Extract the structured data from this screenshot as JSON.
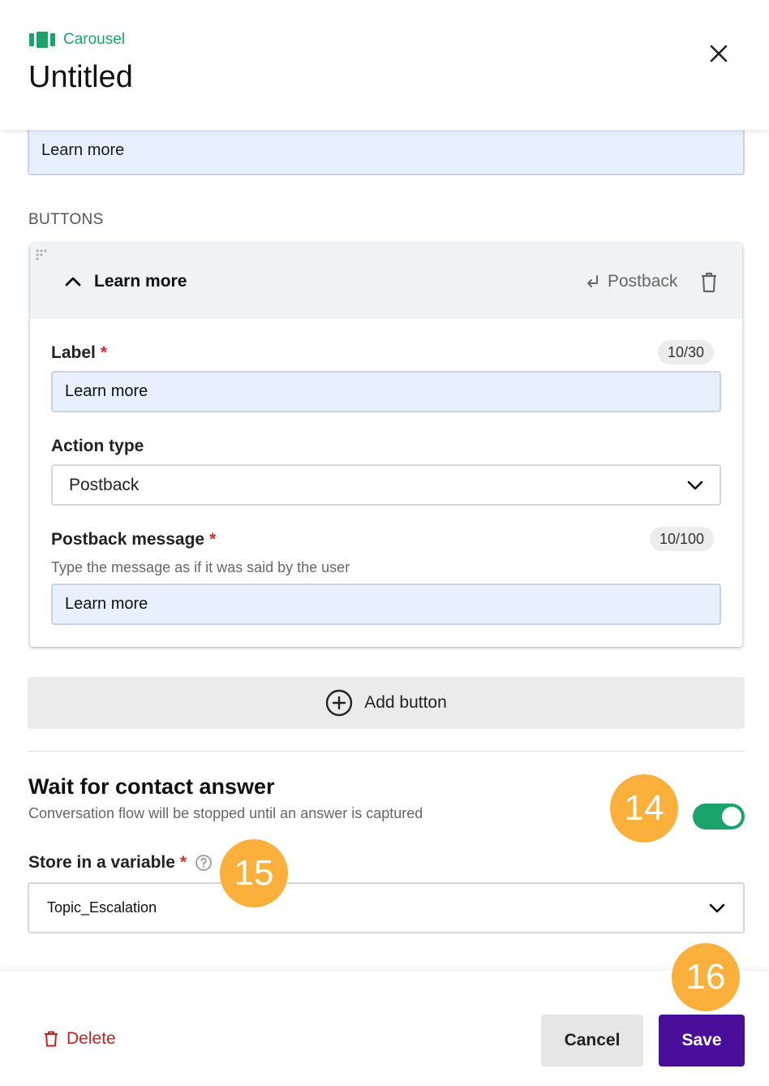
{
  "header": {
    "type_label": "Carousel",
    "title": "Untitled"
  },
  "content": {
    "top_input_value": "Learn more",
    "buttons_section_label": "BUTTONS",
    "button_card": {
      "name": "Learn more",
      "action_indicator": "Postback",
      "label_field": {
        "label": "Label",
        "required_mark": "*",
        "counter": "10/30",
        "value": "Learn more"
      },
      "action_type_field": {
        "label": "Action type",
        "selected": "Postback"
      },
      "postback_field": {
        "label": "Postback message",
        "required_mark": "*",
        "counter": "10/100",
        "helper": "Type the message as if it was said by the user",
        "value": "Learn more"
      }
    },
    "add_button_label": "Add button",
    "wait": {
      "title": "Wait for contact answer",
      "subtitle": "Conversation flow will be stopped until an answer is captured",
      "toggle_on": true
    },
    "store": {
      "label": "Store in a variable",
      "required_mark": "*",
      "selected": "Topic_Escalation"
    }
  },
  "footer": {
    "delete_label": "Delete",
    "cancel_label": "Cancel",
    "save_label": "Save"
  },
  "step_badges": [
    "14",
    "15",
    "16"
  ],
  "colors": {
    "accent_green": "#1aa46b",
    "save_purple": "#4a0e9a",
    "delete_red": "#c5221f",
    "badge_orange": "#fbb03b",
    "input_fill": "#e8f0fe"
  }
}
